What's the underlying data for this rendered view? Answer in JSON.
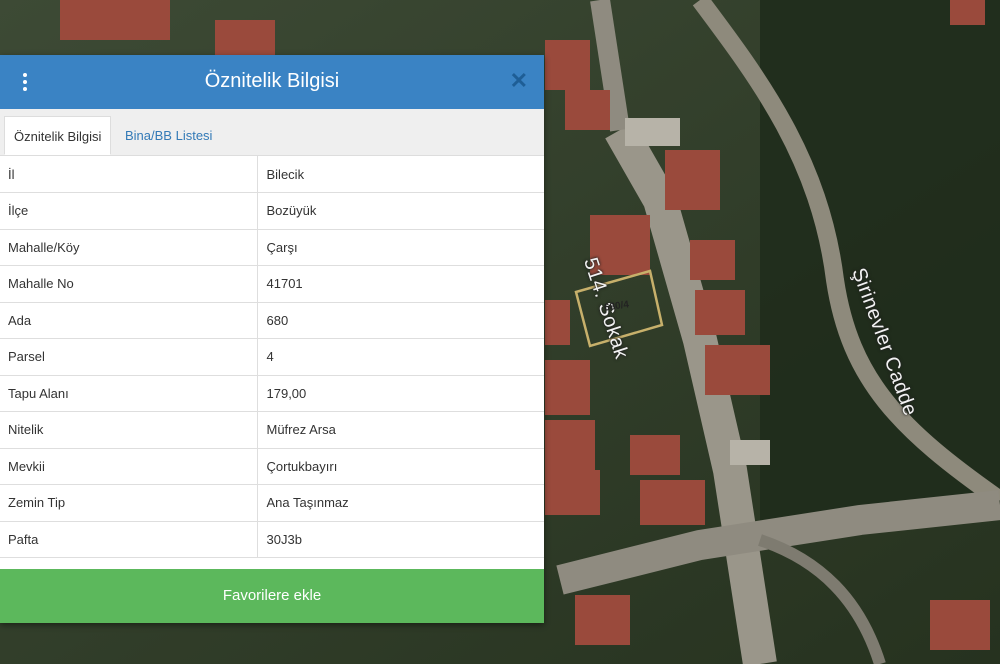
{
  "map": {
    "street_labels": [
      "514. Sokak",
      "Şirinevler Cadde"
    ],
    "parcel_label": "680/4"
  },
  "panel": {
    "title": "Öznitelik Bilgisi",
    "tabs": [
      {
        "label": "Öznitelik Bilgisi",
        "active": true
      },
      {
        "label": "Bina/BB Listesi",
        "active": false
      }
    ],
    "rows": [
      {
        "key": "İl",
        "value": "Bilecik"
      },
      {
        "key": "İlçe",
        "value": "Bozüyük"
      },
      {
        "key": "Mahalle/Köy",
        "value": "Çarşı"
      },
      {
        "key": "Mahalle No",
        "value": "41701"
      },
      {
        "key": "Ada",
        "value": "680"
      },
      {
        "key": "Parsel",
        "value": "4"
      },
      {
        "key": "Tapu Alanı",
        "value": "179,00"
      },
      {
        "key": "Nitelik",
        "value": "Müfrez Arsa"
      },
      {
        "key": "Mevkii",
        "value": "Çortukbayırı"
      },
      {
        "key": "Zemin Tip",
        "value": "Ana Taşınmaz"
      },
      {
        "key": "Pafta",
        "value": "30J3b"
      }
    ],
    "favorite_button": "Favorilere ekle"
  },
  "icons": {
    "menu": "vertical-dots-icon",
    "close": "close-icon"
  },
  "colors": {
    "header": "#3a83c4",
    "button": "#5cb85c",
    "tab_link": "#337ab7"
  }
}
